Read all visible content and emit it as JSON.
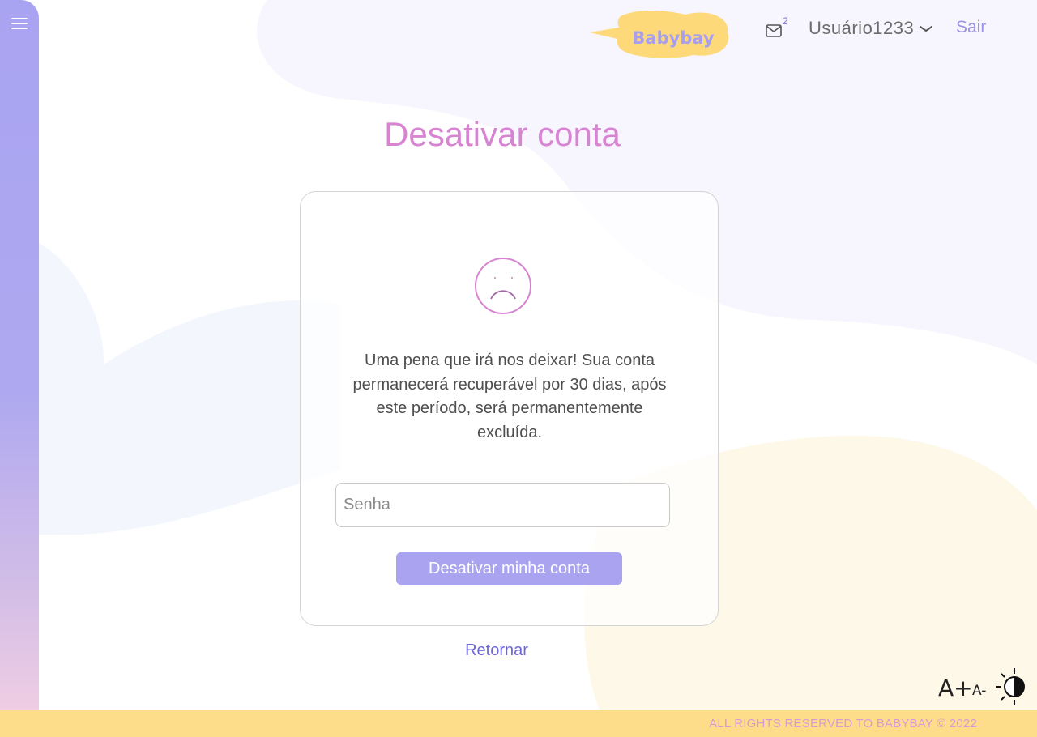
{
  "header": {
    "logo_text": "Babybay",
    "mail_count": "2",
    "username": "Usuário1233",
    "logout_label": "Sair"
  },
  "main": {
    "title": "Desativar conta",
    "message": "Uma pena que irá nos deixar! Sua conta permanecerá recuperável por 30 dias, após este período, será permanentemente excluída.",
    "password_placeholder": "Senha",
    "password_value": "",
    "deactivate_label": "Desativar minha conta",
    "return_label": "Retornar"
  },
  "accessibility": {
    "font_increase": "A+",
    "font_decrease": "A-"
  },
  "footer": {
    "copyright": "ALL RIGHTS RESERVED TO BABYBAY © 2022"
  },
  "colors": {
    "sidebar": "#aaa4f0",
    "title": "#d784d3",
    "button": "#aaa4f0",
    "link": "#6f67d8",
    "footer": "#fddd8a",
    "footer_text": "#d89ad6"
  },
  "icons": [
    "menu-icon",
    "mail-icon",
    "chevron-down-icon",
    "sad-face-icon",
    "contrast-icon"
  ]
}
